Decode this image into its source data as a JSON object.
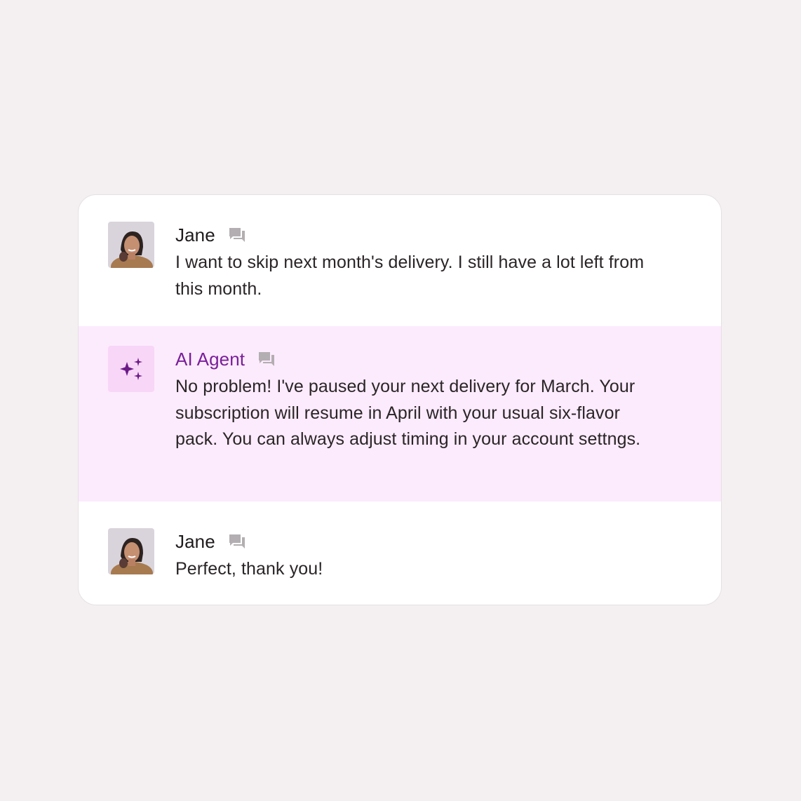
{
  "messages": [
    {
      "sender": "Jane",
      "avatar": "user-photo-avatar",
      "text": "I want to skip next month's delivery. I still have a lot left from this month."
    },
    {
      "sender": "AI Agent",
      "avatar": "sparkles-icon",
      "text": "No problem! I've paused your next delivery for March. Your subscription will resume in April with your usual six-flavor pack. You can always adjust timing in your account settngs."
    },
    {
      "sender": "Jane",
      "avatar": "user-photo-avatar",
      "text": "Perfect, thank you!"
    }
  ],
  "colors": {
    "background": "#f4f0f1",
    "card": "#ffffff",
    "agent_highlight": "#fcebfc",
    "agent_accent": "#7a1f9a",
    "agent_icon_bg": "#f8d6f8",
    "chat_icon": "#b3aeb1"
  }
}
